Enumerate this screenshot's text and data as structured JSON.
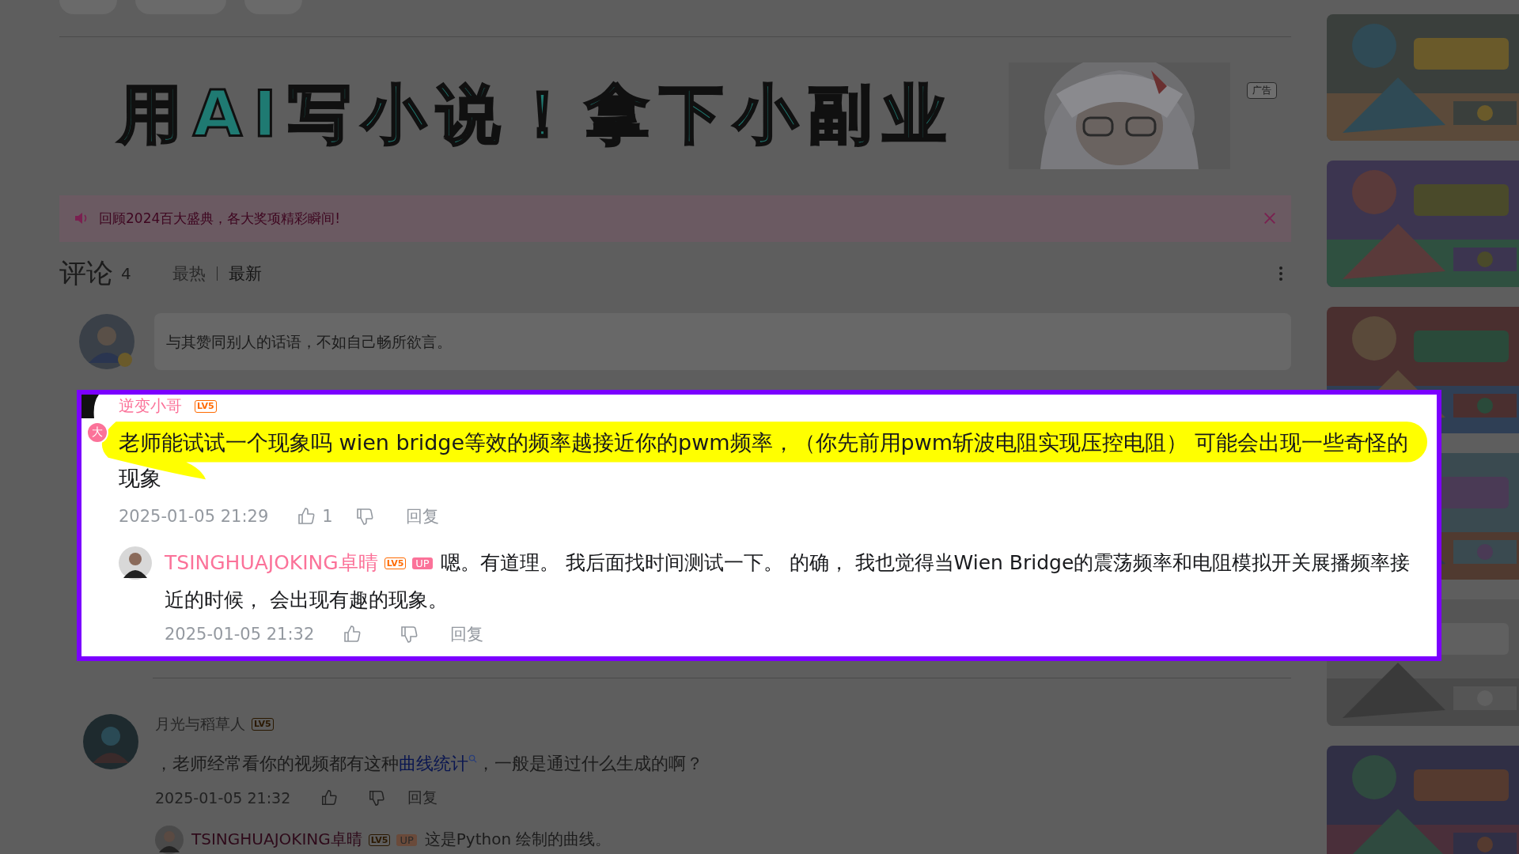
{
  "banner": {
    "headline": "用AI写小说！拿下小副业",
    "ad_badge": "广告"
  },
  "notice": {
    "text": "回顾2024百大盛典，各大奖项精彩瞬间!"
  },
  "comments_header": {
    "title": "评论",
    "count": "4",
    "sorts": [
      {
        "label": "最热",
        "selected": false
      },
      {
        "label": "最新",
        "selected": true
      }
    ]
  },
  "comment_input": {
    "placeholder": "与其赞同别人的话语，不如自己畅所欲言。"
  },
  "highlighted_comment": {
    "highlighted": true,
    "avatar_badge": "大",
    "user": "逆变小哥",
    "level": "LV5",
    "text": "老师能试试一个现象吗 wien bridge等效的频率越接近你的pwm频率，（你先前用pwm斩波电阻实现压控电阻） 可能会出现一些奇怪的现象",
    "time": "2025-01-05 21:29",
    "likes": "1",
    "reply_label": "回复",
    "reply": {
      "user": "TSINGHUAJOKING卓晴",
      "level": "LV5",
      "role": "UP",
      "text": "嗯。有道理。 我后面找时间测试一下。 的确， 我也觉得当Wien Bridge的震荡频率和电阻模拟开关展播频率接近的时候， 会出现有趣的现象。",
      "time": "2025-01-05 21:32",
      "reply_label": "回复"
    }
  },
  "comments": [
    {
      "user": "月光与稻草人",
      "level": "LV5",
      "text_before": "，老师经常看你的视频都有这种",
      "link": "曲线统计",
      "text_after": "，一般是通过什么生成的啊？",
      "time": "2025-01-05 21:32",
      "reply_label": "回复",
      "reply": {
        "user": "TSINGHUAJOKING卓晴",
        "level": "LV5",
        "role": "UP",
        "text": "这是Python 绘制的曲线。"
      }
    }
  ]
}
